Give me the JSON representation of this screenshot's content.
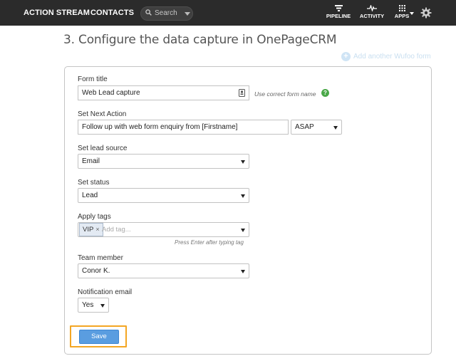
{
  "topbar": {
    "action_stream": "ACTION STREAM",
    "contacts": "CONTACTS",
    "search_placeholder": "Search",
    "pipeline": "PIPELINE",
    "activity": "ACTIVITY",
    "apps": "APPS"
  },
  "page": {
    "heading": "3. Configure the data capture in OnePageCRM",
    "add_another": "Add another Wufoo form"
  },
  "form": {
    "form_title": {
      "label": "Form title",
      "value": "Web Lead capture",
      "hint": "Use correct form name",
      "help": "?"
    },
    "next_action": {
      "label": "Set Next Action",
      "value": "Follow up with web form enquiry from [Firstname]",
      "timing": "ASAP"
    },
    "lead_source": {
      "label": "Set lead source",
      "value": "Email"
    },
    "status": {
      "label": "Set status",
      "value": "Lead"
    },
    "tags": {
      "label": "Apply tags",
      "chip": "VIP",
      "chip_remove": "×",
      "placeholder": "Add tag...",
      "hint": "Press Enter after typing tag"
    },
    "team_member": {
      "label": "Team member",
      "value": "Conor K."
    },
    "notification": {
      "label": "Notification email",
      "value": "Yes"
    },
    "save_label": "Save"
  },
  "colors": {
    "topbar_bg": "#2b2b2b",
    "save_button": "#5a9de0",
    "save_highlight": "#f4a623",
    "help_green": "#4aa848"
  }
}
